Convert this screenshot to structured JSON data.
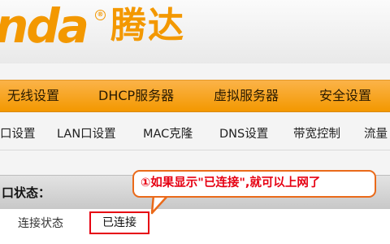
{
  "brand": {
    "logo_text": "nda",
    "logo_reg": "®",
    "logo_cn": "腾达",
    "accent": "#f39800"
  },
  "main_nav": {
    "items": [
      {
        "label": "无线设置"
      },
      {
        "label": "DHCP服务器"
      },
      {
        "label": "虚拟服务器"
      },
      {
        "label": "安全设置"
      }
    ]
  },
  "sub_nav": {
    "items": [
      {
        "label": "口设置"
      },
      {
        "label": "LAN口设置"
      },
      {
        "label": "MAC克隆"
      },
      {
        "label": "DNS设置"
      },
      {
        "label": "带宽控制"
      },
      {
        "label": "流量"
      }
    ]
  },
  "status_panel": {
    "title": "口状态：",
    "rows": [
      {
        "label": "连接状态",
        "value": "已连接"
      }
    ]
  },
  "callout": {
    "text": "①如果显示\"已连接\",就可以上网了",
    "border_color": "#ea6a1a",
    "text_color": "#e60012"
  }
}
